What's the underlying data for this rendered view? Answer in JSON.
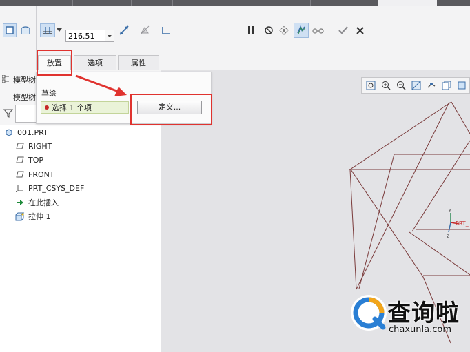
{
  "window_tabs": [
    "",
    "",
    "",
    "",
    "",
    "",
    "",
    "",
    ""
  ],
  "ribbon": {
    "depth_value": "216.51",
    "groups": {
      "type": [
        "solid-icon",
        "surface-icon"
      ],
      "depth": [
        "blind-depth-icon",
        "dropdown-arrow-icon",
        "flip-direction-icon",
        "remove-material-icon",
        "thicken-icon"
      ],
      "controls": [
        "pause-icon",
        "no-preview-icon",
        "verify-preview-icon",
        "dynamic-preview-icon",
        "glasses-icon",
        "ok-icon",
        "cancel-icon"
      ]
    }
  },
  "sub_tabs": {
    "placement": "放置",
    "options": "选项",
    "properties": "属性"
  },
  "popup": {
    "sketch_label": "草绘",
    "collector_text": "选择 1 个项",
    "define_button": "定义..."
  },
  "left_panel": {
    "header_label": "模型树",
    "header_sub": "模型树",
    "tree": [
      {
        "label": "001.PRT",
        "icon": "part-icon"
      },
      {
        "label": "RIGHT",
        "icon": "datum-plane-icon"
      },
      {
        "label": "TOP",
        "icon": "datum-plane-icon"
      },
      {
        "label": "FRONT",
        "icon": "datum-plane-icon"
      },
      {
        "label": "PRT_CSYS_DEF",
        "icon": "csys-icon"
      },
      {
        "label": "在此插入",
        "icon": "insert-here-icon"
      },
      {
        "label": "拉伸 1",
        "icon": "extrude-icon"
      }
    ]
  },
  "graphics": {
    "csys_label": "PRT_",
    "colors": {
      "sketch_line": "#7a3a3a",
      "highlight": "#e0332f"
    }
  },
  "watermark": {
    "title": "查询啦",
    "url": "chaxunla.com"
  }
}
